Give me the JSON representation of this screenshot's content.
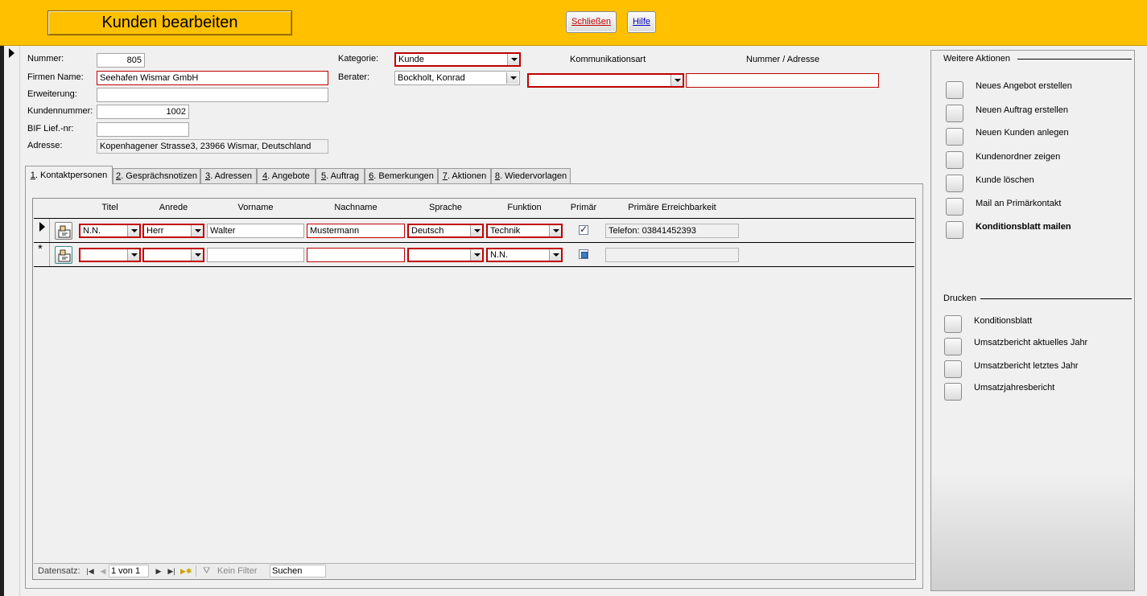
{
  "header": {
    "title": "Kunden bearbeiten",
    "close_label": "Schließen",
    "help_label": "Hilfe"
  },
  "form": {
    "nummer_label": "Nummer:",
    "nummer_value": "805",
    "firmenname_label": "Firmen Name:",
    "firmenname_value": "Seehafen Wismar GmbH",
    "erweiterung_label": "Erweiterung:",
    "erweiterung_value": "",
    "kundennummer_label": "Kundennummer:",
    "kundennummer_value": "1002",
    "bif_label": "BIF Lief.-nr:",
    "bif_value": "",
    "adresse_label": "Adresse:",
    "adresse_value": "Kopenhagener Strasse3, 23966 Wismar, Deutschland",
    "kategorie_label": "Kategorie:",
    "kategorie_value": "Kunde",
    "berater_label": "Berater:",
    "berater_value": "Bockholt, Konrad",
    "kommunikationsart_label": "Kommunikationsart",
    "kommunikationsart_value": "",
    "nummer_adresse_label": "Nummer / Adresse",
    "nummer_adresse_value": ""
  },
  "tabs": [
    {
      "key": "1",
      "label": ". Kontaktpersonen",
      "active": true
    },
    {
      "key": "2",
      "label": ". Gesprächsnotizen"
    },
    {
      "key": "3",
      "label": ". Adressen"
    },
    {
      "key": "4",
      "label": ". Angebote"
    },
    {
      "key": "5",
      "label": ". Auftrag"
    },
    {
      "key": "6",
      "label": ". Bemerkungen"
    },
    {
      "key": "7",
      "label": ". Aktionen"
    },
    {
      "key": "8",
      "label": ". Wiedervorlagen"
    }
  ],
  "grid": {
    "columns": [
      "Titel",
      "Anrede",
      "Vorname",
      "Nachname",
      "Sprache",
      "Funktion",
      "Primär",
      "Primäre Erreichbarkeit"
    ],
    "rows": [
      {
        "titel": "N.N.",
        "anrede": "Herr",
        "vorname": "Walter",
        "nachname": "Mustermann",
        "sprache": "Deutsch",
        "funktion": "Technik",
        "primaer": true,
        "erreichbarkeit": "Telefon: 03841452393"
      },
      {
        "marker": "*",
        "titel": "",
        "anrede": "",
        "vorname": "",
        "nachname": "",
        "sprache": "",
        "funktion": "N.N.",
        "primaer": false,
        "erreichbarkeit": ""
      }
    ]
  },
  "navigation": {
    "label": "Datensatz:",
    "position": "1 von 1",
    "filter": "Kein Filter",
    "search": "Suchen"
  },
  "actions": {
    "title": "Weitere Aktionen",
    "items": [
      {
        "label": "Neues Angebot erstellen"
      },
      {
        "label": "Neuen Auftrag erstellen"
      },
      {
        "label": "Neuen Kunden anlegen"
      },
      {
        "label": "Kundenordner zeigen"
      },
      {
        "label": "Kunde löschen"
      },
      {
        "label": "Mail an Primärkontakt"
      },
      {
        "label": "Konditionsblatt mailen",
        "bold": true
      }
    ]
  },
  "print": {
    "title": "Drucken",
    "items": [
      {
        "label": "Konditionsblatt"
      },
      {
        "label": "Umsatzbericht aktuelles Jahr"
      },
      {
        "label": "Umsatzbericht letztes Jahr"
      },
      {
        "label": "Umsatzjahresbericht"
      }
    ]
  },
  "colors": {
    "header_bg": "#ffc000",
    "required_border": "#c00000",
    "close_text": "#c00000",
    "help_text": "#0000c0"
  }
}
